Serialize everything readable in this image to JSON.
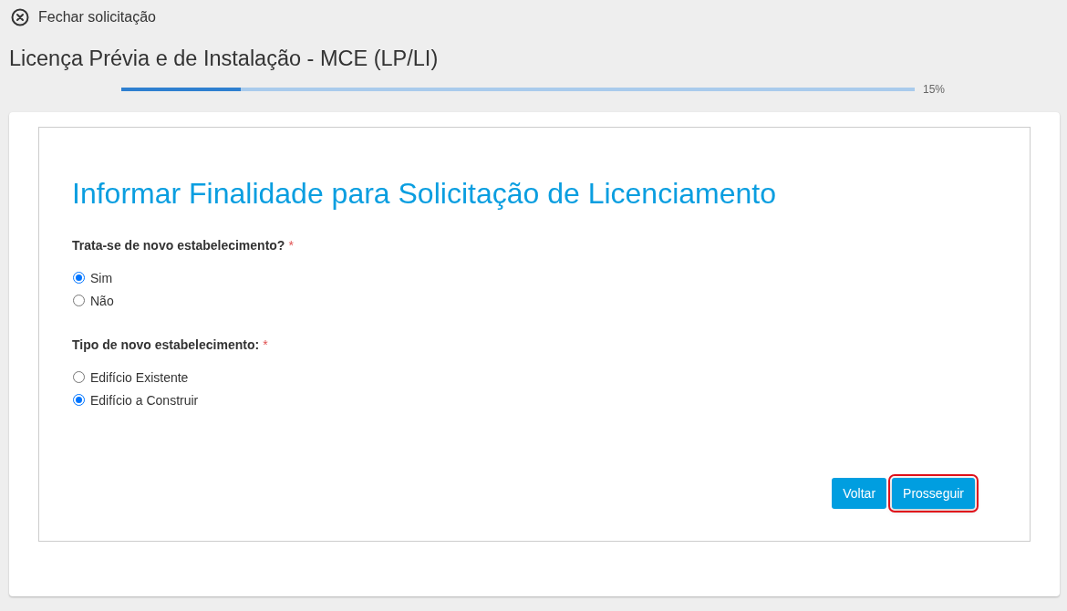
{
  "header": {
    "close_link": "Fechar solicitação"
  },
  "title": "Licença Prévia e de Instalação - MCE (LP/LI)",
  "progress": {
    "level": 0.15,
    "reading": "15%"
  },
  "form": {
    "heading": "Informar Finalidade para Solicitação de Licenciamento",
    "questions": [
      {
        "label": "Trata-se de novo estabelecimento?",
        "required_mark": "*",
        "options": [
          {
            "label": "Sim",
            "selected": true
          },
          {
            "label": "Não",
            "selected": false
          }
        ]
      },
      {
        "label": "Tipo de novo estabelecimento:",
        "required_mark": "*",
        "options": [
          {
            "label": "Edifício Existente",
            "selected": false
          },
          {
            "label": "Edifício a Construir",
            "selected": true
          }
        ]
      }
    ]
  },
  "buttons": [
    {
      "label": "Voltar",
      "focused": false
    },
    {
      "label": "Prosseguir",
      "focused": true
    }
  ]
}
